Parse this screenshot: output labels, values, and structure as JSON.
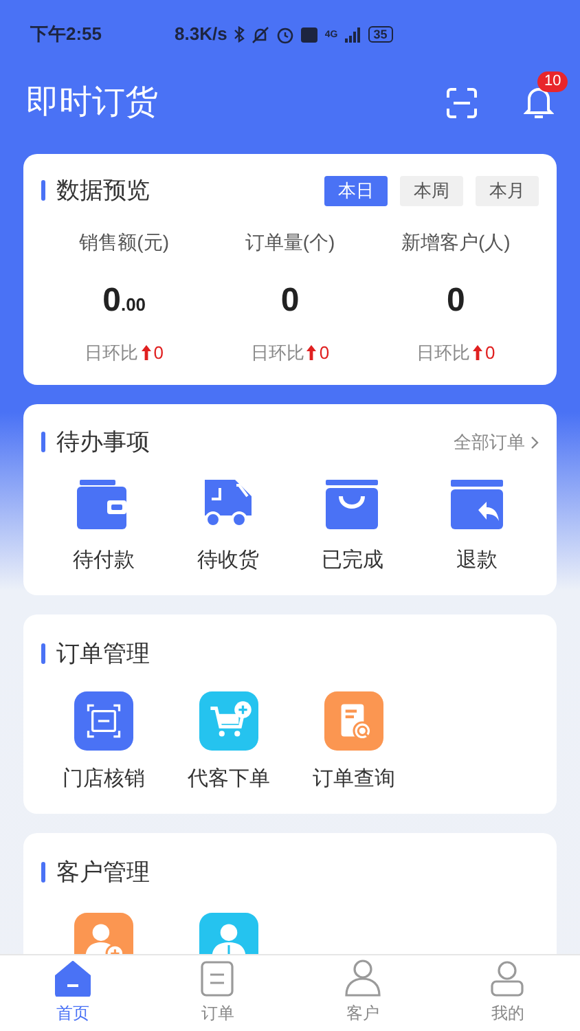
{
  "status_bar": {
    "time": "下午2:55",
    "speed": "8.3K/s",
    "network": "4G",
    "battery": "35"
  },
  "header": {
    "title": "即时订货",
    "notification_count": "10"
  },
  "overview": {
    "title": "数据预览",
    "periods": [
      {
        "label": "本日",
        "selected": true
      },
      {
        "label": "本周",
        "selected": false
      },
      {
        "label": "本月",
        "selected": false
      }
    ],
    "stats": [
      {
        "label": "销售额(元)",
        "value": "0",
        "fraction": ".00",
        "compare_label": "日环比",
        "kind": "up",
        "change": "0"
      },
      {
        "label": "订单量(个)",
        "value": "0",
        "compare_label": "日环比",
        "kind": "up",
        "change": "0"
      },
      {
        "label": "新增客户(人)",
        "value": "0",
        "compare_label": "日环比",
        "kind": "up",
        "change": "0"
      }
    ]
  },
  "todo": {
    "title": "待办事项",
    "link": "全部订单",
    "items": [
      {
        "kind": "wallet",
        "label": "待付款"
      },
      {
        "kind": "truck",
        "label": "待收货"
      },
      {
        "kind": "bag",
        "label": "已完成"
      },
      {
        "kind": "refund",
        "label": "退款"
      }
    ]
  },
  "order_management": {
    "title": "订单管理",
    "items": [
      {
        "kind": "scan",
        "label": "门店核销",
        "color": "#4a72f5"
      },
      {
        "kind": "cart",
        "label": "代客下单",
        "color": "#25c3ef"
      },
      {
        "kind": "search-doc",
        "label": "订单查询",
        "color": "#fb9651"
      }
    ]
  },
  "customer_management": {
    "title": "客户管理",
    "items": [
      {
        "kind": "add-user",
        "color": "#fb9651"
      },
      {
        "kind": "user",
        "color": "#25c3ef"
      }
    ]
  },
  "tab_bar": [
    {
      "kind": "home",
      "label": "首页",
      "selected": true
    },
    {
      "kind": "order",
      "label": "订单",
      "selected": false
    },
    {
      "kind": "customer",
      "label": "客户",
      "selected": false
    },
    {
      "kind": "me",
      "label": "我的",
      "selected": false
    }
  ]
}
